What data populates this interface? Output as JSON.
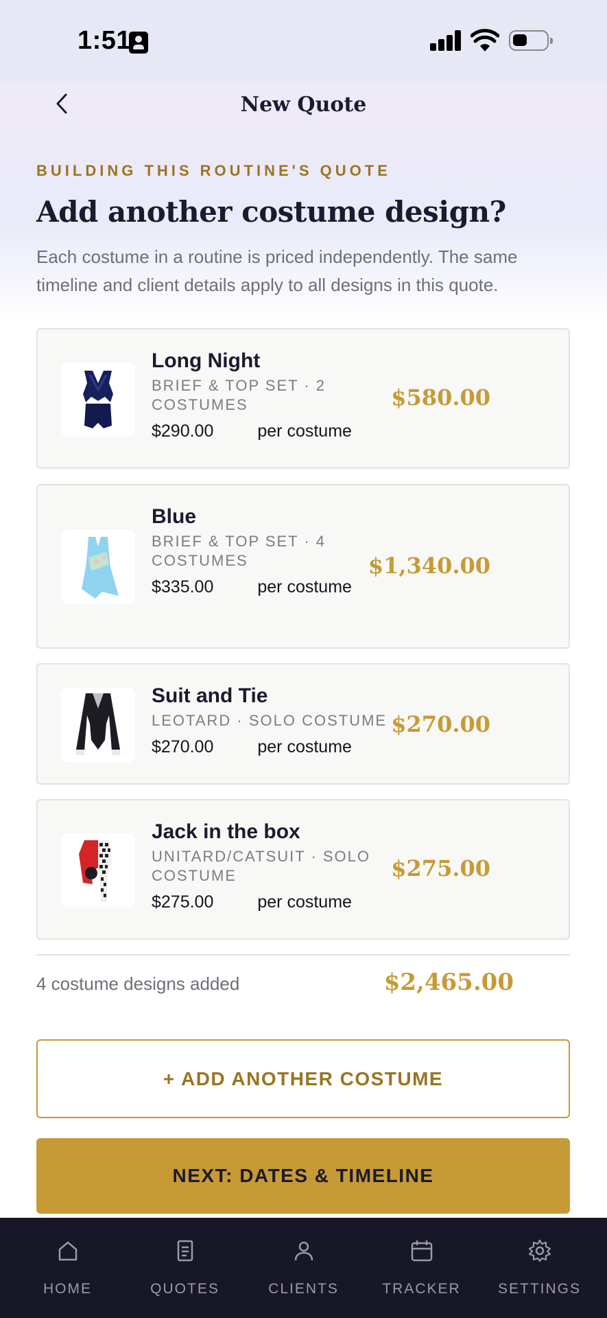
{
  "status_bar": {
    "time": "1:51"
  },
  "nav": {
    "title": "New Quote"
  },
  "header": {
    "eyebrow": "BUILDING THIS ROUTINE'S QUOTE",
    "title": "Add another costume design?",
    "description": "Each costume in a routine is priced independently. The same timeline and client details apply to all designs in this quote."
  },
  "costumes": [
    {
      "name": "Long Night",
      "meta": "Brief & Top Set · 2 costumes",
      "unit_price": "$290.00",
      "unit_label": "per costume",
      "total": "$580.00"
    },
    {
      "name": "Blue",
      "meta": "Brief & Top Set · 4 costumes",
      "unit_price": "$335.00",
      "unit_label": "per costume",
      "total": "$1,340.00"
    },
    {
      "name": "Suit and Tie",
      "meta": "Leotard · Solo costume",
      "unit_price": "$270.00",
      "unit_label": "per costume",
      "total": "$270.00"
    },
    {
      "name": "Jack in the box",
      "meta": "Unitard/Catsuit · Solo costume",
      "unit_price": "$275.00",
      "unit_label": "per costume",
      "total": "$275.00"
    }
  ],
  "summary": {
    "count_text": "4 costume designs added",
    "total": "$2,465.00"
  },
  "actions": {
    "add_label": "+ ADD ANOTHER COSTUME",
    "next_label": "NEXT: DATES & TIMELINE"
  },
  "tabs": [
    {
      "label": "HOME",
      "icon": "home-icon"
    },
    {
      "label": "QUOTES",
      "icon": "document-icon"
    },
    {
      "label": "CLIENTS",
      "icon": "person-icon"
    },
    {
      "label": "TRACKER",
      "icon": "calendar-icon"
    },
    {
      "label": "SETTINGS",
      "icon": "gear-icon"
    }
  ],
  "colors": {
    "accent": "#c69a35",
    "eyebrow": "#9a7422",
    "tabbar": "#181727",
    "ink": "#1b1a2e"
  }
}
